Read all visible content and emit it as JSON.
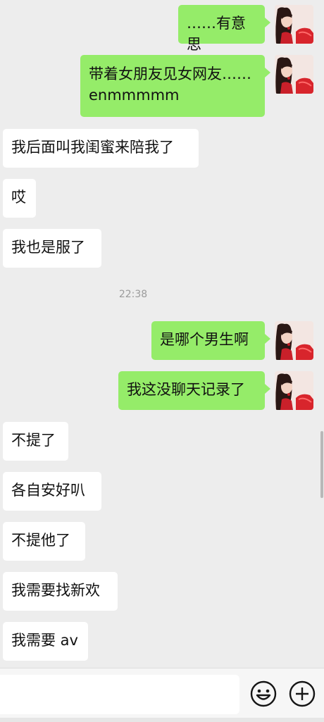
{
  "messages": [
    {
      "side": "out",
      "text": "……有意思"
    },
    {
      "side": "out",
      "text": "带着女朋友见女网友……\nenmmmmm"
    },
    {
      "side": "in",
      "text": "我后面叫我闺蜜来陪我了"
    },
    {
      "side": "in",
      "text": "哎"
    },
    {
      "side": "in",
      "text": "我也是服了"
    },
    {
      "side": "time",
      "text": "22:38"
    },
    {
      "side": "out",
      "text": "是哪个男生啊"
    },
    {
      "side": "out",
      "text": "我这没聊天记录了"
    },
    {
      "side": "in",
      "text": "不提了"
    },
    {
      "side": "in",
      "text": "各自安好叭"
    },
    {
      "side": "in",
      "text": "不提他了"
    },
    {
      "side": "in",
      "text": "我需要找新欢"
    },
    {
      "side": "in",
      "text": "我需要 av"
    }
  ],
  "input": {
    "value": "",
    "placeholder": ""
  },
  "icons": {
    "avatar": "avatar-image",
    "emoji": "emoji-icon",
    "more": "plus-icon"
  },
  "colors": {
    "background": "#ededed",
    "outgoing_bubble": "#95ec69",
    "incoming_bubble": "#ffffff"
  }
}
